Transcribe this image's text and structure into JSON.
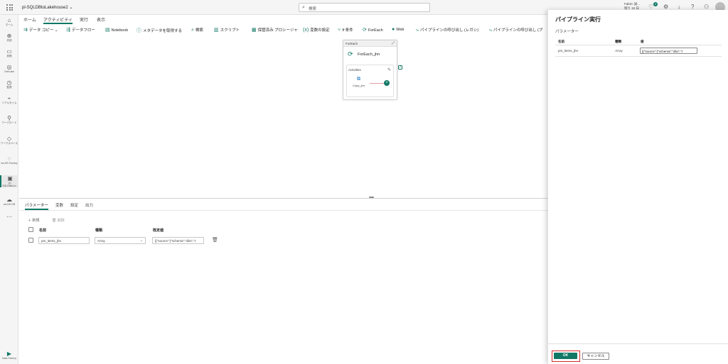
{
  "app": {
    "title": "pl-SQLDBtoLakehouse2",
    "title_chevron": "⌄"
  },
  "search": {
    "placeholder": "検索"
  },
  "trial": {
    "line1": "Fabric 試...",
    "line2": "残り 10 日"
  },
  "notifications": {
    "count": "4"
  },
  "rail": {
    "items": [
      {
        "icon": "⌂",
        "label": "ホーム"
      },
      {
        "icon": "⊕",
        "label": "作成"
      },
      {
        "icon": "▭",
        "label": "参照"
      },
      {
        "icon": "◎",
        "label": "OneLake"
      },
      {
        "icon": "◷",
        "label": "監視"
      },
      {
        "icon": "⌁",
        "label": "リアルタイム"
      },
      {
        "icon": "⚲",
        "label": "ワークロード"
      },
      {
        "icon": "◇",
        "label": "ワークスペース"
      },
      {
        "icon": "◌",
        "label": "ws-DE-Factory"
      },
      {
        "icon": "▣",
        "label": "pl-SQLDBtoLa..."
      },
      {
        "icon": "☁",
        "label": "ws-DE-DB"
      },
      {
        "icon": "⋯",
        "label": ""
      }
    ],
    "bottom": {
      "icon": "▶",
      "label": "Data Factory"
    }
  },
  "tabs": [
    "ホーム",
    "アクティビティ",
    "実行",
    "表示"
  ],
  "toolbar": [
    {
      "icon": "⇉",
      "label": "データ コピー ⌄"
    },
    {
      "icon": "⇶",
      "label": "データフロー"
    },
    {
      "icon": "▤",
      "label": "Notebook"
    },
    {
      "icon": "ⓘ",
      "label": "メタデータを取得する"
    },
    {
      "icon": "⌕",
      "label": "検索"
    },
    {
      "icon": "▥",
      "label": "スクリプト"
    },
    {
      "icon": "▦",
      "label": "保管済み プロシージャ"
    },
    {
      "icon": "(x)",
      "label": "変数の設定"
    },
    {
      "icon": "⑂",
      "label": "If 条件"
    },
    {
      "icon": "⟳",
      "label": "ForEach"
    },
    {
      "icon": "●",
      "label": "Web"
    },
    {
      "icon": "⤷",
      "label": "パイプラインの呼び出し (レガシ)"
    },
    {
      "icon": "⤷",
      "label": "パイプラインの呼び出し (プ"
    }
  ],
  "canvas": {
    "foreach": {
      "header": "ForEach",
      "name": "ForEach_jhn",
      "activities_label": "Activities",
      "inner_activity": "Copy_jhn",
      "expand_icon": "⤢",
      "pencil_icon": "✎",
      "plus": "+",
      "check": "✓"
    }
  },
  "panel": {
    "tabs": [
      "パラメーター",
      "変数",
      "設定",
      "出力"
    ],
    "new_label": "＋ 新規",
    "delete_label": "🗑 削除",
    "columns": [
      "名前",
      "種類",
      "既定値"
    ],
    "rows": [
      {
        "name": "pm_items_jhn",
        "type": "Array",
        "default": "[{\"source\":{\"schema\":\"dbo\",\"t"
      }
    ]
  },
  "run_panel": {
    "title": "パイプライン実行",
    "subtitle": "パラメーター",
    "columns": [
      "名前",
      "種類",
      "値"
    ],
    "rows": [
      {
        "name": "pm_items_jhn",
        "type": "Array",
        "value": "[{\"source\":{\"schema\":\"dbo\",\"t"
      }
    ],
    "ok_label": "OK",
    "cancel_label": "キャンセル"
  },
  "colors": {
    "accent": "#117865",
    "highlight": "#d92b2b"
  }
}
